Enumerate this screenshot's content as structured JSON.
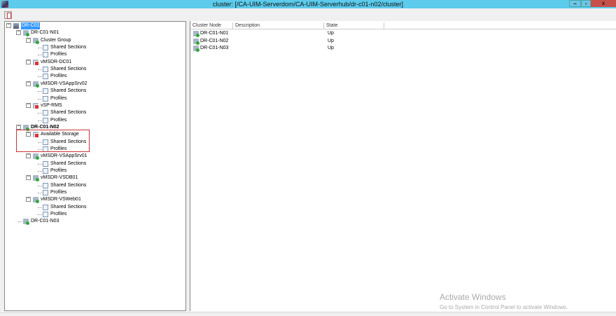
{
  "window": {
    "title": "cluster: [/CA-UIM-Serverdom/CA-UIM-Serverhub/dr-c01-n02/cluster]",
    "minimize": "–",
    "restore": "▫",
    "close": "x"
  },
  "tree": [
    {
      "label": "DR-C01",
      "depth": 0,
      "icon": "root",
      "selected": true
    },
    {
      "label": "DR-C01-N01",
      "depth": 1,
      "icon": "ok"
    },
    {
      "label": "Cluster Group",
      "depth": 2,
      "icon": "ok"
    },
    {
      "label": "Shared Sections",
      "depth": 3,
      "icon": "doc"
    },
    {
      "label": "Profiles",
      "depth": 3,
      "icon": "doc"
    },
    {
      "label": "vMSDR-DC01",
      "depth": 2,
      "icon": "err"
    },
    {
      "label": "Shared Sections",
      "depth": 3,
      "icon": "doc"
    },
    {
      "label": "Profiles",
      "depth": 3,
      "icon": "doc"
    },
    {
      "label": "vMSDR-VSAppSrv02",
      "depth": 2,
      "icon": "ok"
    },
    {
      "label": "Shared Sections",
      "depth": 3,
      "icon": "doc"
    },
    {
      "label": "Profiles",
      "depth": 3,
      "icon": "doc"
    },
    {
      "label": "vSP-RMS",
      "depth": 2,
      "icon": "err"
    },
    {
      "label": "Shared Sections",
      "depth": 3,
      "icon": "doc"
    },
    {
      "label": "Profiles",
      "depth": 3,
      "icon": "doc"
    },
    {
      "label": "DR-C01-N02",
      "depth": 1,
      "icon": "ok",
      "bold": true
    },
    {
      "label": "Available Storage",
      "depth": 2,
      "icon": "err"
    },
    {
      "label": "Shared Sections",
      "depth": 3,
      "icon": "doc"
    },
    {
      "label": "Profiles",
      "depth": 3,
      "icon": "doc"
    },
    {
      "label": "vMSDR-VSAppSrv01",
      "depth": 2,
      "icon": "ok"
    },
    {
      "label": "Shared Sections",
      "depth": 3,
      "icon": "doc"
    },
    {
      "label": "Profiles",
      "depth": 3,
      "icon": "doc"
    },
    {
      "label": "vMSDR-VSDB01",
      "depth": 2,
      "icon": "ok"
    },
    {
      "label": "Shared Sections",
      "depth": 3,
      "icon": "doc"
    },
    {
      "label": "Profiles",
      "depth": 3,
      "icon": "doc"
    },
    {
      "label": "vMSDR-VSWeb01",
      "depth": 2,
      "icon": "ok"
    },
    {
      "label": "Shared Sections",
      "depth": 3,
      "icon": "doc"
    },
    {
      "label": "Profiles",
      "depth": 3,
      "icon": "doc"
    },
    {
      "label": "DR-C01-N03",
      "depth": 1,
      "icon": "ok",
      "leaf": true
    }
  ],
  "list": {
    "columns": [
      "Cluster Node",
      "Description",
      "State"
    ],
    "rows": [
      {
        "node": "DR-C01-N01",
        "description": "",
        "state": "Up"
      },
      {
        "node": "DR-C01-N02",
        "description": "",
        "state": "Up"
      },
      {
        "node": "DR-C01-N03",
        "description": "",
        "state": "Up"
      }
    ]
  },
  "watermark": {
    "title": "Activate Windows",
    "subtitle": "Go to System in Control Panel to activate Windows."
  }
}
